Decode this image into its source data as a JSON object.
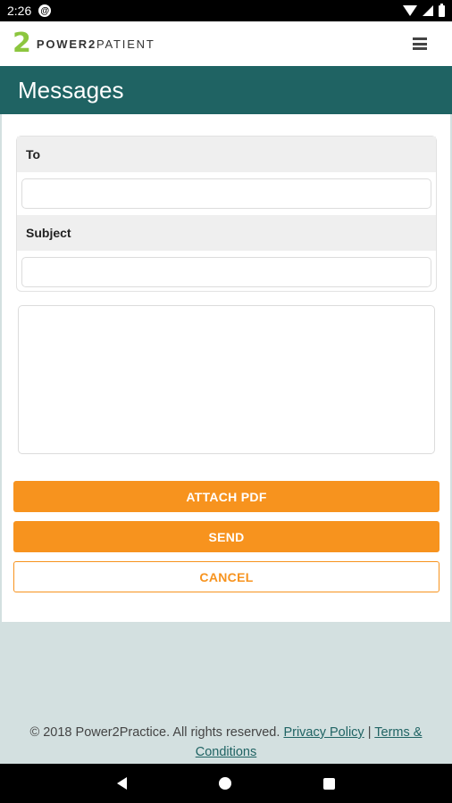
{
  "status_bar": {
    "time": "2:26"
  },
  "header": {
    "logo_mark": "2",
    "brand_bold": "POWER2",
    "brand_light": "PATIENT"
  },
  "page": {
    "title": "Messages"
  },
  "form": {
    "to_label": "To",
    "to_value": "",
    "subject_label": "Subject",
    "subject_value": "",
    "body_value": ""
  },
  "buttons": {
    "attach": "ATTACH PDF",
    "send": "SEND",
    "cancel": "CANCEL"
  },
  "footer": {
    "copyright": "© 2018 Power2Practice. All rights reserved.",
    "privacy": "Privacy Policy",
    "separator": "|",
    "terms": "Terms & Conditions"
  },
  "colors": {
    "accent": "#f7931e",
    "title_bar": "#1f6363",
    "logo": "#8cc63f",
    "background": "#d3e0e0"
  }
}
